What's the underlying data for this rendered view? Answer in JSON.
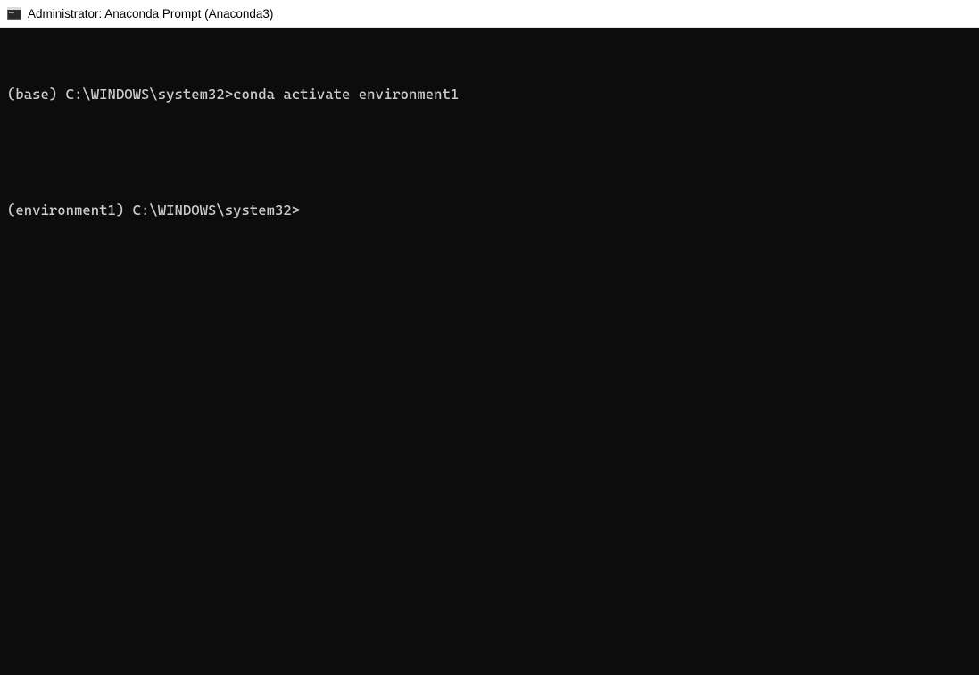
{
  "window": {
    "title": "Administrator: Anaconda Prompt (Anaconda3)"
  },
  "terminal": {
    "lines": [
      {
        "prompt": "(base) C:\\WINDOWS\\system32>",
        "command": "conda activate environment1"
      },
      {
        "prompt": "",
        "command": ""
      },
      {
        "prompt": "(environment1) C:\\WINDOWS\\system32>",
        "command": ""
      }
    ]
  }
}
